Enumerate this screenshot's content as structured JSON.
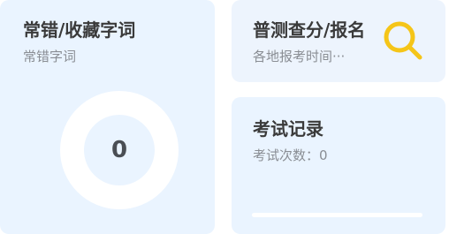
{
  "wrong_words_card": {
    "title": "常错/收藏字词",
    "subtitle": "常错字词",
    "count": "0"
  },
  "survey_card": {
    "title": "普测查分/报名",
    "subtitle": "各地报考时间···",
    "icon": "search-icon",
    "icon_color": "#f5c518"
  },
  "exam_card": {
    "title": "考试记录",
    "subtitle": "考试次数：0",
    "progress": 0
  }
}
